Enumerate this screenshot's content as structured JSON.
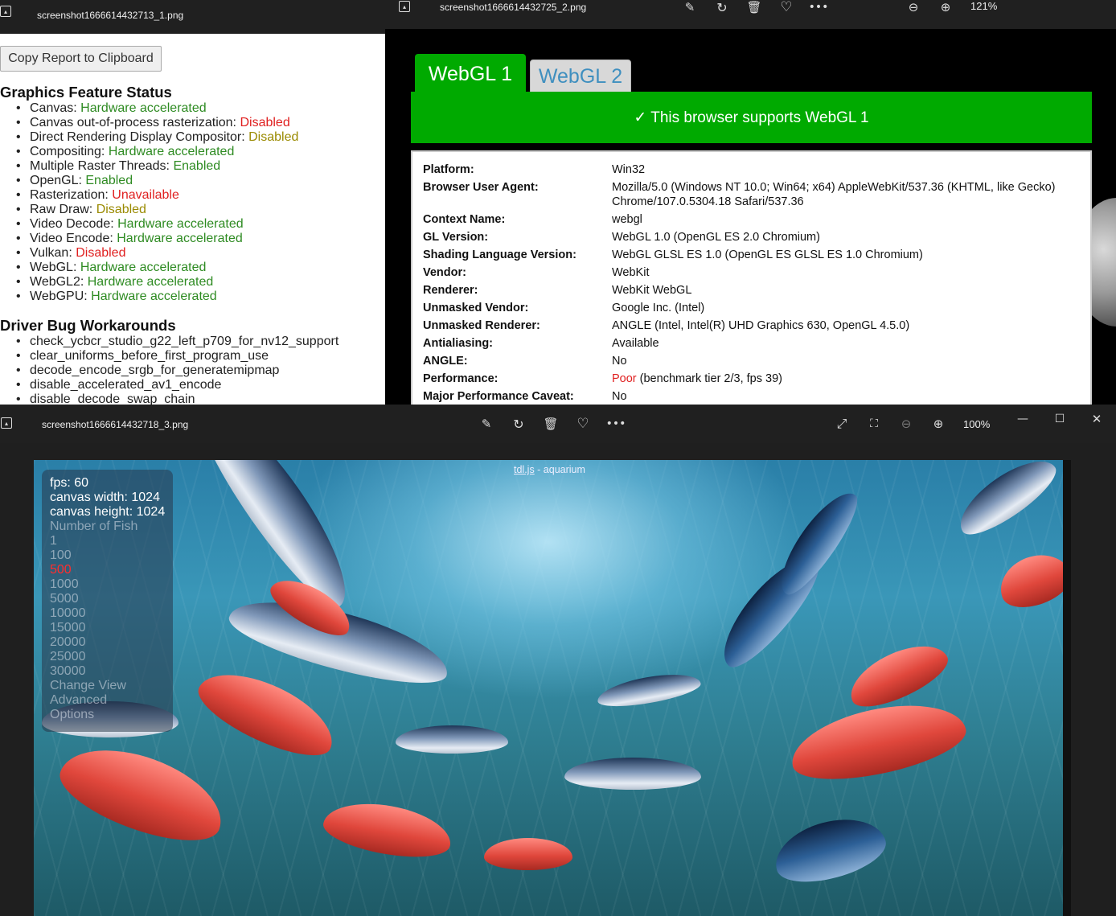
{
  "window1": {
    "title": "screenshot1666614432713_1.png",
    "copy_button": "Copy Report to Clipboard",
    "feature_heading": "Graphics Feature Status",
    "features": [
      {
        "name": "Canvas:",
        "status": "Hardware accelerated",
        "color": "#2e8b22"
      },
      {
        "name": "Canvas out-of-process rasterization:",
        "status": "Disabled",
        "color": "#e02020"
      },
      {
        "name": "Direct Rendering Display Compositor:",
        "status": "Disabled",
        "color": "#9a8a00"
      },
      {
        "name": "Compositing:",
        "status": "Hardware accelerated",
        "color": "#2e8b22"
      },
      {
        "name": "Multiple Raster Threads:",
        "status": "Enabled",
        "color": "#2e8b22"
      },
      {
        "name": "OpenGL:",
        "status": "Enabled",
        "color": "#2e8b22"
      },
      {
        "name": "Rasterization:",
        "status": "Unavailable",
        "color": "#e02020"
      },
      {
        "name": "Raw Draw:",
        "status": "Disabled",
        "color": "#9a8a00"
      },
      {
        "name": "Video Decode:",
        "status": "Hardware accelerated",
        "color": "#2e8b22"
      },
      {
        "name": "Video Encode:",
        "status": "Hardware accelerated",
        "color": "#2e8b22"
      },
      {
        "name": "Vulkan:",
        "status": "Disabled",
        "color": "#e02020"
      },
      {
        "name": "WebGL:",
        "status": "Hardware accelerated",
        "color": "#2e8b22"
      },
      {
        "name": "WebGL2:",
        "status": "Hardware accelerated",
        "color": "#2e8b22"
      },
      {
        "name": "WebGPU:",
        "status": "Hardware accelerated",
        "color": "#2e8b22"
      }
    ],
    "workaround_heading": "Driver Bug Workarounds",
    "workarounds": [
      "check_ycbcr_studio_g22_left_p709_for_nv12_support",
      "clear_uniforms_before_first_program_use",
      "decode_encode_srgb_for_generatemipmap",
      "disable_accelerated_av1_encode",
      "disable_decode_swap_chain"
    ]
  },
  "window2": {
    "title": "screenshot1666614432725_2.png",
    "zoom": "121%",
    "tab_active": "WebGL 1",
    "tab_inactive": "WebGL 2",
    "banner": "✓ This browser supports WebGL 1",
    "rows": [
      {
        "key": "Platform:",
        "value": "Win32"
      },
      {
        "key": "Browser User Agent:",
        "value": "Mozilla/5.0 (Windows NT 10.0; Win64; x64) AppleWebKit/537.36 (KHTML, like Gecko)",
        "value2": "Chrome/107.0.5304.18 Safari/537.36"
      },
      {
        "key": "Context Name:",
        "value": "webgl"
      },
      {
        "key": "GL Version:",
        "value": "WebGL 1.0 (OpenGL ES 2.0 Chromium)"
      },
      {
        "key": "Shading Language Version:",
        "value": "WebGL GLSL ES 1.0 (OpenGL ES GLSL ES 1.0 Chromium)"
      },
      {
        "key": "Vendor:",
        "value": "WebKit"
      },
      {
        "key": "Renderer:",
        "value": "WebKit WebGL"
      },
      {
        "key": "Unmasked Vendor:",
        "value": "Google Inc. (Intel)"
      },
      {
        "key": "Unmasked Renderer:",
        "value": "ANGLE (Intel, Intel(R) UHD Graphics 630, OpenGL 4.5.0)"
      },
      {
        "key": "Antialiasing:",
        "value": "Available"
      },
      {
        "key": "ANGLE:",
        "value": "No"
      },
      {
        "key": "Performance:",
        "value_poor": "Poor",
        "value": " (benchmark tier 2/3, fps 39)"
      },
      {
        "key": "Major Performance Caveat:",
        "value": "No"
      }
    ]
  },
  "window3": {
    "title": "screenshot1666614432718_3.png",
    "zoom": "100%",
    "canvas_title_link": "tdl.js",
    "canvas_title_rest": " - aquarium",
    "stats": [
      "fps: 60",
      "canvas width: 1024",
      "canvas height: 1024"
    ],
    "fish_label": "Number of Fish",
    "fish_options": [
      "1",
      "100",
      "500",
      "1000",
      "5000",
      "10000",
      "15000",
      "20000",
      "25000",
      "30000"
    ],
    "selected_fish": "500",
    "menu": [
      "Change View",
      "Advanced",
      "Options"
    ]
  }
}
